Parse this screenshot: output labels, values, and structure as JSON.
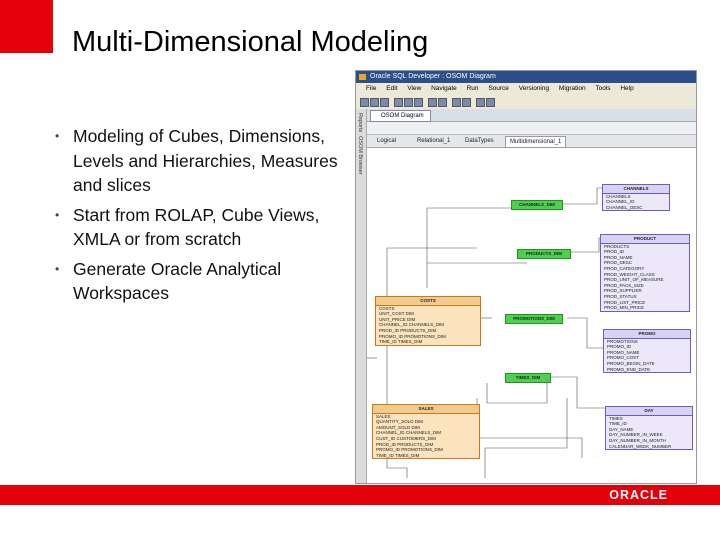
{
  "slide": {
    "title": "Multi-Dimensional Modeling",
    "bullets": [
      "Modeling of Cubes, Dimensions, Levels and Hierarchies, Measures and slices",
      "Start from ROLAP, Cube Views, XMLA or from scratch",
      "Generate Oracle Analytical Workspaces"
    ],
    "logo_text": "ORACLE",
    "colors": {
      "accent_red": "#e3000b"
    }
  },
  "screenshot": {
    "window_title": "Oracle SQL Developer : OSOM Diagram",
    "menu": [
      "File",
      "Edit",
      "View",
      "Navigate",
      "Run",
      "Source",
      "Versioning",
      "Migration",
      "Tools",
      "Help"
    ],
    "doc_tab": "OSOM Diagram",
    "side_tabs": [
      "Reports",
      "OSOM Browser"
    ],
    "sub_tabs": [
      "Logical",
      "Relational_1",
      "DataTypes",
      "Multidimensional_1"
    ],
    "tables": {
      "channels": {
        "name": "CHANNELS",
        "rows": [
          "CHANNELS",
          "CHANNEL_ID",
          "CHANNEL_DESC"
        ]
      },
      "channels_dim": {
        "name": "CHANNELS_DIM"
      },
      "products": {
        "name": "PRODUCT",
        "rows": [
          "PRODUCTS",
          "PROD_ID",
          "PROD_NAME",
          "PROD_DESC",
          "PROD_CATEGORY",
          "PROD_WEIGHT_CLASS",
          "PROD_UNIT_OF_MEASURE",
          "PROD_PACK_SIZE",
          "PROD_SUPPLIER",
          "PROD_STATUS",
          "PROD_LIST_PRICE",
          "PROD_MIN_PRICE"
        ]
      },
      "products_dim": {
        "name": "PRODUCTS_DIM"
      },
      "costs": {
        "name": "COSTS",
        "rows": [
          "COSTS",
          "UNIT_COST   DIM",
          "UNIT_PRICE   DIM",
          "CHANNEL_ID   CHANNELS_DIM",
          "PROD_ID   PRODUCTS_DIM",
          "PROMO_ID   PROMOTIONS_DIM",
          "TIME_ID   TIMES_DIM"
        ]
      },
      "promotions_dim": {
        "name": "PROMOTIONS_DIM"
      },
      "promo": {
        "name": "PROMO",
        "rows": [
          "PROMOTIONS",
          "PROMO_ID",
          "PROMO_NAME",
          "PROMO_COST",
          "PROMO_BEGIN_DATE",
          "PROMO_END_DATE"
        ]
      },
      "times_dim": {
        "name": "TIMES_DIM"
      },
      "sales": {
        "name": "SALES",
        "rows": [
          "SALES",
          "QUANTITY_SOLD   DIM",
          "AMOUNT_SOLD   DIM",
          "CHANNEL_ID   CHANNELS_DIM",
          "CUST_ID   CUSTOMERS_DIM",
          "PROD_ID   PRODUCTS_DIM",
          "PROMO_ID   PROMOTIONS_DIM",
          "TIME_ID   TIMES_DIM"
        ]
      },
      "day": {
        "name": "DAY",
        "rows": [
          "TIMES",
          "TIME_ID",
          "DAY_NAME",
          "DAY_NUMBER_IN_WEEK",
          "DAY_NUMBER_IN_MONTH",
          "CALENDAR_WEEK_NUMBER"
        ]
      }
    }
  }
}
